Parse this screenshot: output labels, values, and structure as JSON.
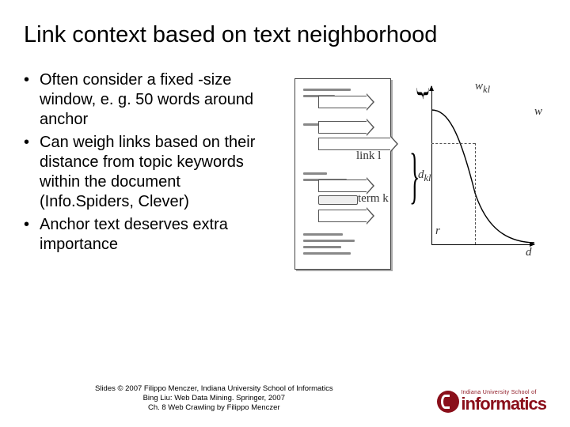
{
  "title": "Link context based on text neighborhood",
  "bullets": [
    "Often consider a fixed -size window, e. g. 50 words around anchor",
    "Can weigh links based on their distance from topic keywords within the document (Info.Spiders, Clever)",
    "Anchor text deserves extra importance"
  ],
  "diagram": {
    "labels": {
      "link": "link l",
      "term": "term k",
      "w": "w",
      "wkl": "w_kl",
      "dkl": "d_kl",
      "r": "r",
      "d": "d"
    }
  },
  "footer": {
    "line1": "Slides © 2007 Filippo Menczer, Indiana University School of Informatics",
    "line2": "Bing Liu: Web Data Mining. Springer, 2007",
    "line3": "Ch. 8 Web Crawling by Filippo Menczer"
  },
  "logo": {
    "sup": "Indiana University School of",
    "main": "informatics"
  }
}
